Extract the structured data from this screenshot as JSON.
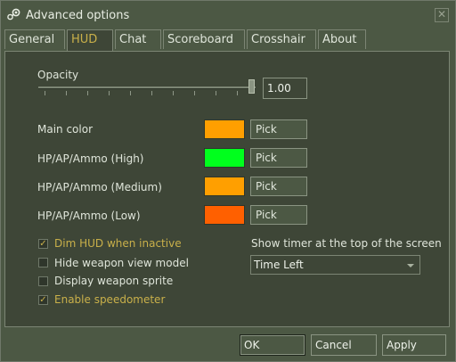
{
  "window": {
    "title": "Advanced options",
    "icons": {
      "app": "steam-icon",
      "close": "close-icon"
    }
  },
  "tabs": [
    {
      "label": "General",
      "active": false
    },
    {
      "label": "HUD",
      "active": true
    },
    {
      "label": "Chat",
      "active": false
    },
    {
      "label": "Scoreboard",
      "active": false
    },
    {
      "label": "Crosshair",
      "active": false
    },
    {
      "label": "About",
      "active": false
    }
  ],
  "hud": {
    "opacity": {
      "label": "Opacity",
      "value_text": "1.00",
      "level": 1.0
    },
    "colors": [
      {
        "label": "Main color",
        "swatch": "#ff9f00",
        "pick": "Pick"
      },
      {
        "label": "HP/AP/Ammo (High)",
        "swatch": "#00ff1d",
        "pick": "Pick"
      },
      {
        "label": "HP/AP/Ammo (Medium)",
        "swatch": "#ff9f00",
        "pick": "Pick"
      },
      {
        "label": "HP/AP/Ammo (Low)",
        "swatch": "#ff6000",
        "pick": "Pick"
      }
    ],
    "checkboxes": [
      {
        "label": "Dim HUD when inactive",
        "checked": true
      },
      {
        "label": "Hide weapon view model",
        "checked": false
      },
      {
        "label": "Display weapon sprite",
        "checked": false
      },
      {
        "label": "Enable speedometer",
        "checked": true
      }
    ],
    "timer": {
      "label": "Show timer at the top of the screen",
      "selected": "Time Left"
    }
  },
  "buttons": {
    "ok": "OK",
    "cancel": "Cancel",
    "apply": "Apply"
  },
  "theme": {
    "accent": "#c9b04a",
    "panel_bg": "#3e4637",
    "window_bg": "#4c5844"
  }
}
